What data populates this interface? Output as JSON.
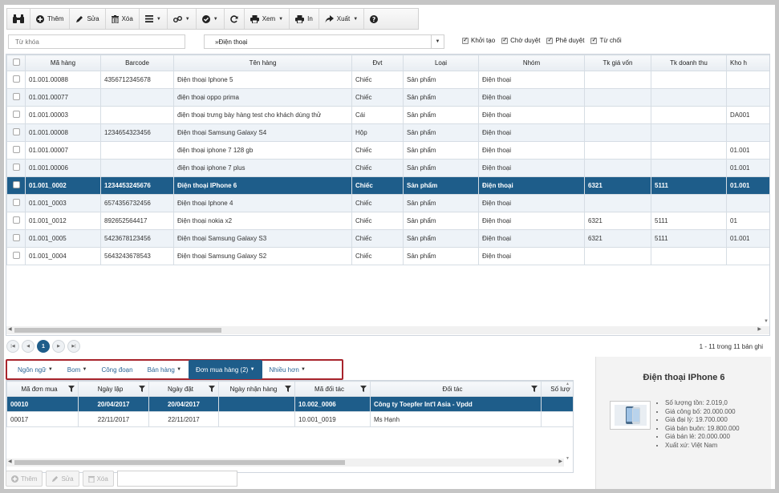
{
  "toolbar": {
    "them": "Thêm",
    "sua": "Sửa",
    "xoa": "Xóa",
    "xem": "Xem",
    "in": "In",
    "xuat": "Xuất"
  },
  "filter": {
    "keyword_placeholder": "Từ khóa",
    "group_value": "»Điện thoại",
    "checks": [
      {
        "label": "Khởi tạo",
        "checked": true
      },
      {
        "label": "Chờ duyệt",
        "checked": true
      },
      {
        "label": "Phê duyệt",
        "checked": true
      },
      {
        "label": "Từ chối",
        "checked": true
      }
    ]
  },
  "grid": {
    "columns": [
      "Mã hàng",
      "Barcode",
      "Tên hàng",
      "Đvt",
      "Loại",
      "Nhóm",
      "Tk giá vốn",
      "Tk doanh thu",
      "Kho h"
    ],
    "rows": [
      [
        "01.001.00088",
        "4356712345678",
        "Điện thoại Iphone 5",
        "Chiếc",
        "Sản phẩm",
        "Điện thoại",
        "",
        "",
        ""
      ],
      [
        "01.001.00077",
        "",
        "điện thoại oppo prima",
        "Chiếc",
        "Sản phẩm",
        "Điện thoại",
        "",
        "",
        ""
      ],
      [
        "01.001.00003",
        "",
        "điện thoại trưng bày hàng test cho khách dùng thử",
        "Cái",
        "Sản phẩm",
        "Điện thoại",
        "",
        "",
        "DA001"
      ],
      [
        "01.001.00008",
        "1234654323456",
        "Điện thoại Samsung Galaxy S4",
        "Hộp",
        "Sản phẩm",
        "Điện thoại",
        "",
        "",
        ""
      ],
      [
        "01.001.00007",
        "",
        "điện thoại iphone 7 128 gb",
        "Chiếc",
        "Sản phẩm",
        "Điện thoại",
        "",
        "",
        "01.001"
      ],
      [
        "01.001.00006",
        "",
        "điện thoại iphone 7 plus",
        "Chiếc",
        "Sản phẩm",
        "Điện thoại",
        "",
        "",
        "01.001"
      ],
      [
        "01.001_0002",
        "1234453245676",
        "Điện thoại IPhone 6",
        "Chiếc",
        "Sản phẩm",
        "Điện thoại",
        "6321",
        "5111",
        "01.001"
      ],
      [
        "01.001_0003",
        "6574356732456",
        "Điện thoại Iphone 4",
        "Chiếc",
        "Sản phẩm",
        "Điện thoại",
        "",
        "",
        ""
      ],
      [
        "01.001_0012",
        "892652564417",
        "Điện thoại nokia x2",
        "Chiếc",
        "Sản phẩm",
        "Điện thoại",
        "6321",
        "5111",
        "01"
      ],
      [
        "01.001_0005",
        "5423678123456",
        "Điện thoại Samsung Galaxy S3",
        "Chiếc",
        "Sản phẩm",
        "Điện thoại",
        "6321",
        "5111",
        "01.001"
      ],
      [
        "01.001_0004",
        "5643243678543",
        "Điện thoại Samsung Galaxy S2",
        "Chiếc",
        "Sản phẩm",
        "Điện thoại",
        "",
        "",
        ""
      ]
    ],
    "selected_index": 6
  },
  "pager": {
    "page": "1",
    "info": "1 - 11 trong 11 bản ghi"
  },
  "tabs": [
    {
      "label": "Ngôn ngữ",
      "dropdown": true
    },
    {
      "label": "Bom",
      "dropdown": true
    },
    {
      "label": "Công đoạn",
      "dropdown": false
    },
    {
      "label": "Bán hàng",
      "dropdown": true
    },
    {
      "label": "Đơn mua hàng (2)",
      "dropdown": true,
      "active": true
    },
    {
      "label": "Nhiều hơn",
      "dropdown": true
    }
  ],
  "orders": {
    "columns": [
      "Mã đơn mua",
      "Ngày lập",
      "Ngày đặt",
      "Ngày nhận hàng",
      "Mã đối tác",
      "Đối tác",
      "Số lượ"
    ],
    "rows": [
      [
        "00010",
        "20/04/2017",
        "20/04/2017",
        "",
        "10.002_0006",
        "Công ty Toepfer Int'l Asia - Vpdd",
        ""
      ],
      [
        "00017",
        "22/11/2017",
        "22/11/2017",
        "",
        "10.001_0019",
        "Ms Hạnh",
        ""
      ]
    ],
    "selected_index": 0
  },
  "bottom_buttons": {
    "them": "Thêm",
    "sua": "Sửa",
    "xoa": "Xóa"
  },
  "detail": {
    "title": "Điện thoại IPhone 6",
    "items": [
      "Số lượng tồn: 2.019,0",
      "Giá công bố: 20.000.000",
      "Giá đại lý: 19.700.000",
      "Giá bán buôn: 19.800.000",
      "Giá bán lẻ: 20.000.000",
      "Xuất xứ: Việt Nam"
    ]
  },
  "colors": {
    "selected_row": "#1e5d8a",
    "tab_highlight_border": "#a8242c",
    "link_blue": "#2a6496"
  }
}
